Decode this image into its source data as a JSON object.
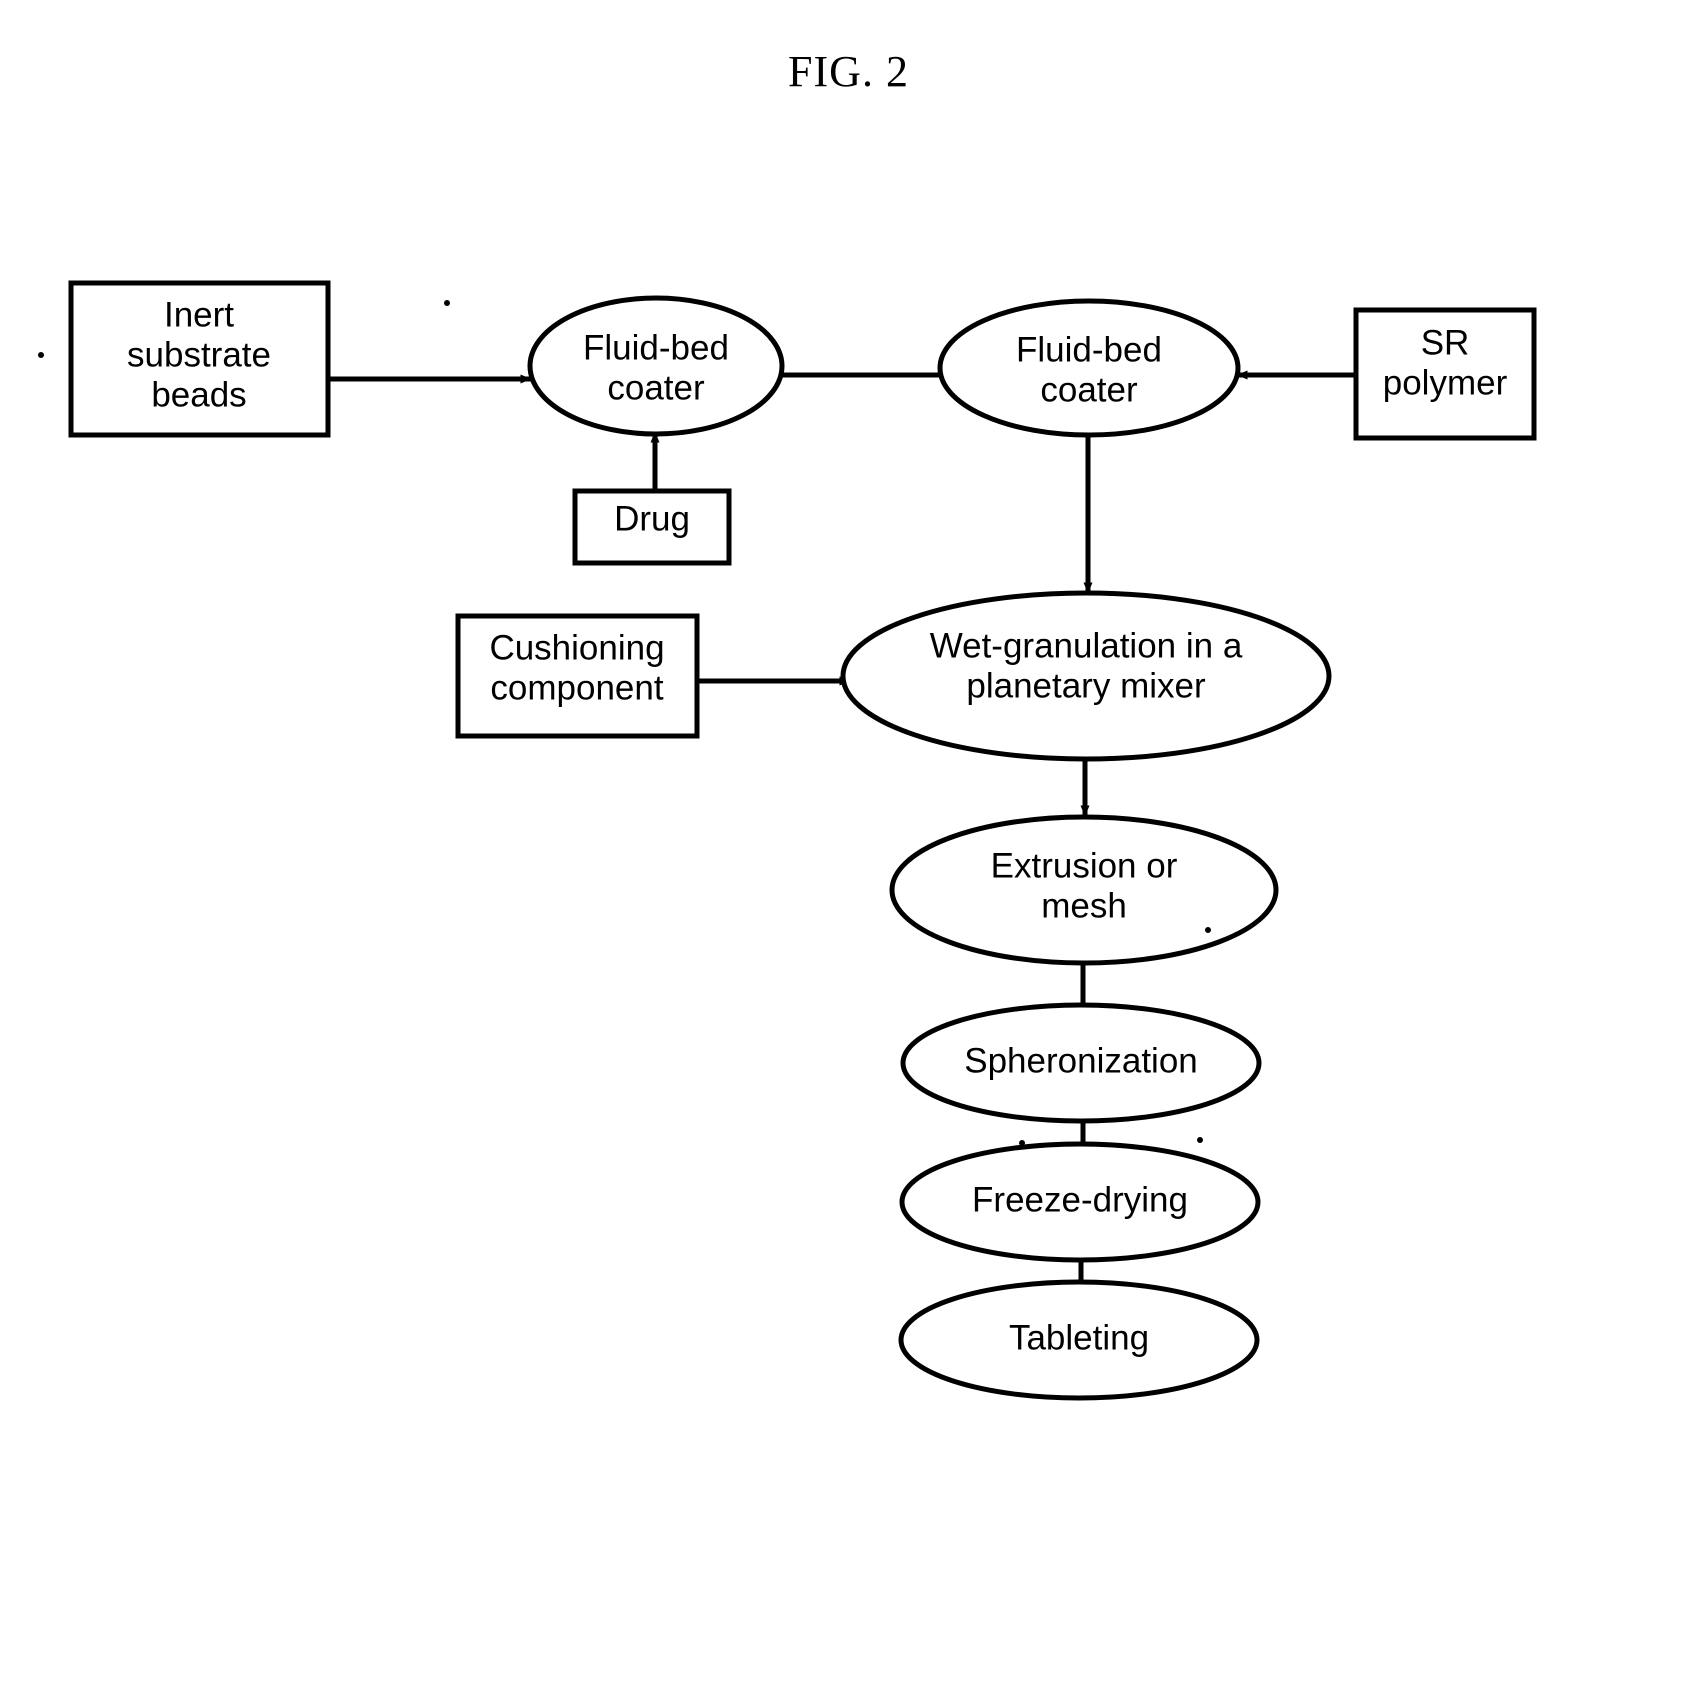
{
  "figure": {
    "title": "FIG. 2",
    "type": "process-flow-diagram",
    "stroke_color": "#000000",
    "fill_color": "#ffffff",
    "background_color": "#ffffff"
  },
  "nodes": {
    "inert_substrate_beads": {
      "shape": "rectangle",
      "lines": [
        "Inert",
        "substrate",
        "beads"
      ],
      "text": "Inert substrate beads"
    },
    "fluid_bed_coater_1": {
      "shape": "ellipse",
      "lines": [
        "Fluid-bed",
        "coater"
      ],
      "text": "Fluid-bed coater"
    },
    "fluid_bed_coater_2": {
      "shape": "ellipse",
      "lines": [
        "Fluid-bed",
        "coater"
      ],
      "text": "Fluid-bed coater"
    },
    "sr_polymer": {
      "shape": "rectangle",
      "lines": [
        "SR",
        "polymer"
      ],
      "text": "SR polymer"
    },
    "drug": {
      "shape": "rectangle",
      "lines": [
        "Drug"
      ],
      "text": "Drug"
    },
    "cushioning_component": {
      "shape": "rectangle",
      "lines": [
        "Cushioning",
        "component"
      ],
      "text": "Cushioning component"
    },
    "wet_granulation": {
      "shape": "ellipse",
      "lines": [
        "Wet-granulation in a",
        "planetary mixer"
      ],
      "text": "Wet-granulation in a planetary mixer"
    },
    "extrusion_or_mesh": {
      "shape": "ellipse",
      "lines": [
        "Extrusion or",
        "mesh"
      ],
      "text": "Extrusion or mesh"
    },
    "spheronization": {
      "shape": "ellipse",
      "lines": [
        "Spheronization"
      ],
      "text": "Spheronization"
    },
    "freeze_drying": {
      "shape": "ellipse",
      "lines": [
        "Freeze-drying"
      ],
      "text": "Freeze-drying"
    },
    "tableting": {
      "shape": "ellipse",
      "lines": [
        "Tableting"
      ],
      "text": "Tableting"
    }
  },
  "edges": [
    {
      "from": "inert_substrate_beads",
      "to": "fluid_bed_coater_1",
      "direction": "right"
    },
    {
      "from": "drug",
      "to": "fluid_bed_coater_1",
      "direction": "up"
    },
    {
      "from": "fluid_bed_coater_1",
      "to": "fluid_bed_coater_2",
      "direction": "right"
    },
    {
      "from": "sr_polymer",
      "to": "fluid_bed_coater_2",
      "direction": "left"
    },
    {
      "from": "fluid_bed_coater_2",
      "to": "wet_granulation",
      "direction": "down"
    },
    {
      "from": "cushioning_component",
      "to": "wet_granulation",
      "direction": "right"
    },
    {
      "from": "wet_granulation",
      "to": "extrusion_or_mesh",
      "direction": "down"
    },
    {
      "from": "extrusion_or_mesh",
      "to": "spheronization",
      "direction": "down"
    },
    {
      "from": "spheronization",
      "to": "freeze_drying",
      "direction": "down"
    },
    {
      "from": "freeze_drying",
      "to": "tableting",
      "direction": "down"
    }
  ]
}
